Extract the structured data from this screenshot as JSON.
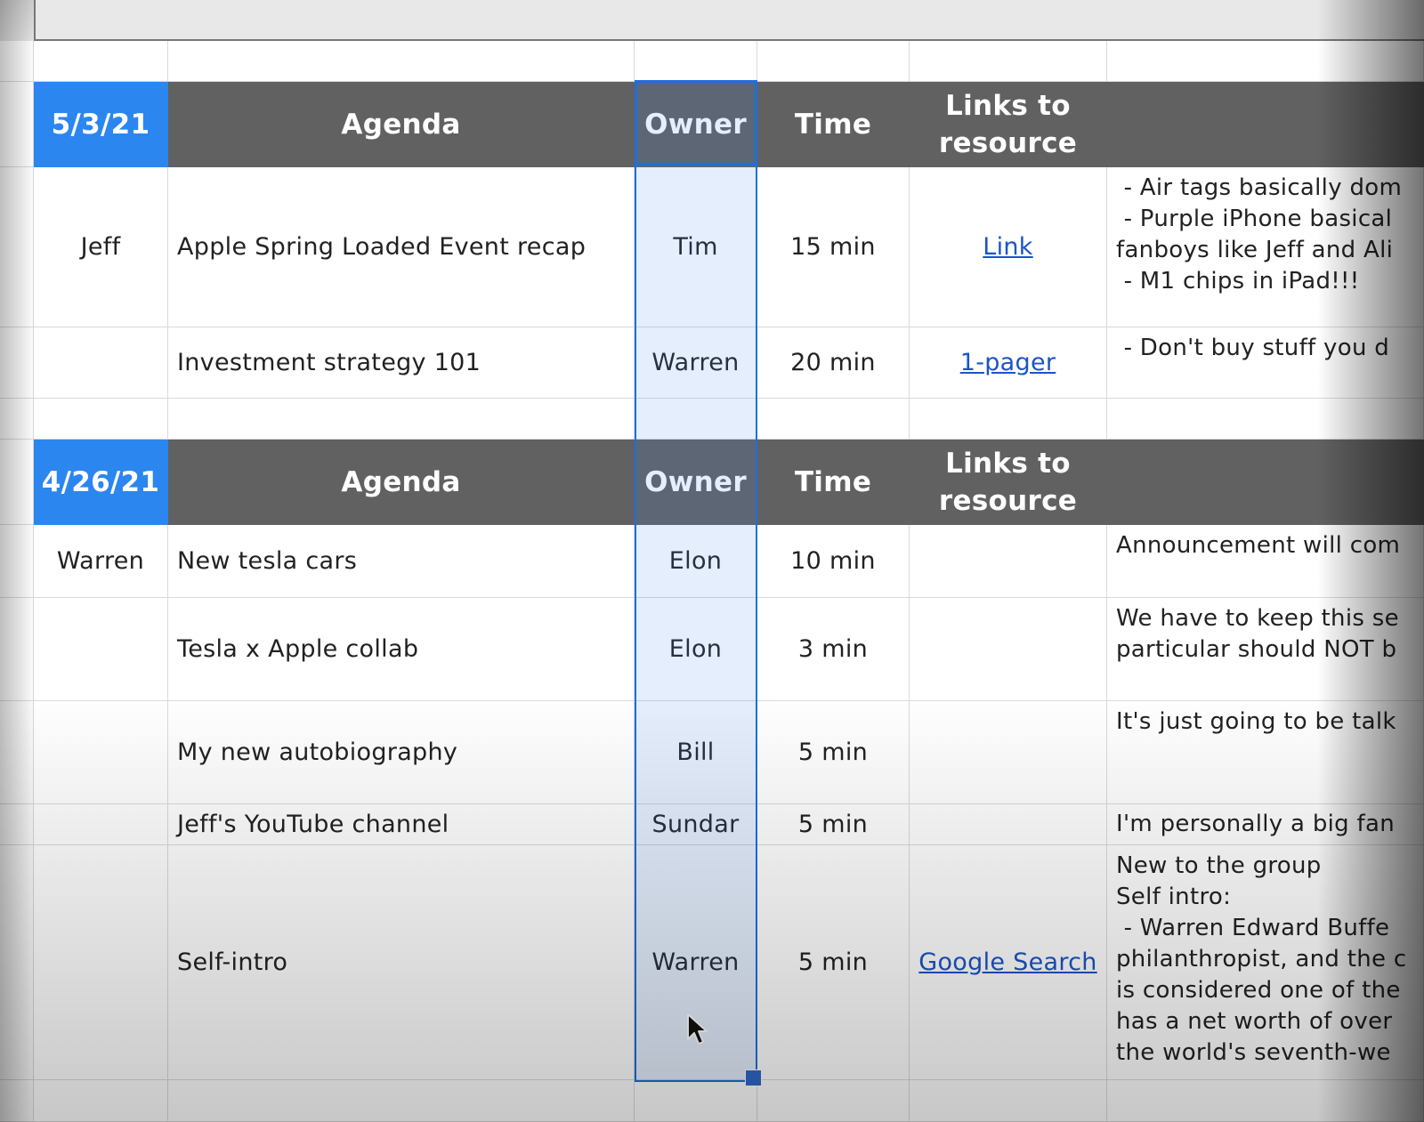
{
  "sheet": {
    "section1": {
      "date": "5/3/21",
      "headers": {
        "agenda": "Agenda",
        "owner": "Owner",
        "time": "Time",
        "links": "Links to resource"
      },
      "host": "Jeff",
      "rows": [
        {
          "agenda": "Apple Spring Loaded Event recap",
          "owner": "Tim",
          "time": "15 min",
          "link": "Link",
          "notes": " - Air tags basically dom\n - Purple iPhone basical\nfanboys like Jeff and Ali\n - M1 chips in iPad!!!"
        },
        {
          "agenda": "Investment strategy 101",
          "owner": "Warren",
          "time": "20 min",
          "link": "1-pager",
          "notes": " - Don't buy stuff you d"
        }
      ]
    },
    "section2": {
      "date": "4/26/21",
      "headers": {
        "agenda": "Agenda",
        "owner": "Owner",
        "time": "Time",
        "links": "Links to resource"
      },
      "host": "Warren",
      "rows": [
        {
          "agenda": "New tesla cars",
          "owner": "Elon",
          "time": "10 min",
          "link": "",
          "notes": "Announcement will com"
        },
        {
          "agenda": "Tesla x Apple collab",
          "owner": "Elon",
          "time": "3 min",
          "link": "",
          "notes": "We have to keep this se\nparticular should NOT b"
        },
        {
          "agenda": "My new autobiography",
          "owner": "Bill",
          "time": "5 min",
          "link": "",
          "notes": "It's just going to be talk"
        },
        {
          "agenda": "Jeff's YouTube channel",
          "owner": "Sundar",
          "time": "5 min",
          "link": "",
          "notes": "I'm personally a big fan"
        },
        {
          "agenda": "Self-intro",
          "owner": "Warren",
          "time": "5 min",
          "link": "Google Search",
          "notes": "New to the group\nSelf intro:\n - Warren Edward Buffe\nphilanthropist, and the c\nis considered one of the\nhas a net worth of over \nthe world's seventh-we"
        }
      ]
    }
  },
  "colors": {
    "date_bg": "#2b86f0",
    "header_bg": "#616161",
    "selection": "#1c6fe0",
    "link": "#1a55c6"
  }
}
